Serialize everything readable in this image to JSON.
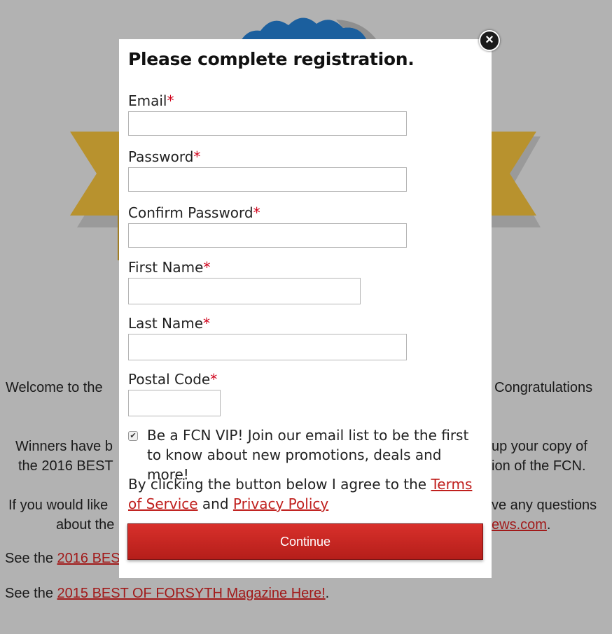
{
  "background": {
    "welcome_left": "Welcome to the",
    "welcome_right": "Congratulations",
    "winners_left": "Winners have b",
    "winners_right": "up your copy of",
    "mag_left": "the 2016 BEST",
    "mag_right": "ion of the FCN.",
    "contact_left": "If you would like",
    "contact_right": "ve any questions",
    "about_left": "about the",
    "about_link": "ews.com",
    "about_end": ".",
    "see_2016_prefix": "See the ",
    "see_2016_link": "2016 BES",
    "see_2015_prefix": "See the ",
    "see_2015_link": "2015 BEST OF FORSYTH Magazine Here!",
    "see_2015_end": "."
  },
  "modal": {
    "title": "Please complete registration.",
    "close_glyph": "×",
    "fields": {
      "email": {
        "label": "Email",
        "value": ""
      },
      "password": {
        "label": "Password",
        "value": ""
      },
      "confirm_password": {
        "label": "Confirm Password",
        "value": ""
      },
      "first_name": {
        "label": "First Name",
        "value": ""
      },
      "last_name": {
        "label": "Last Name",
        "value": ""
      },
      "postal_code": {
        "label": "Postal Code",
        "value": ""
      }
    },
    "required_mark": "*",
    "vip": {
      "checked": true,
      "check_glyph": "✔",
      "text": "Be a FCN VIP! Join our email list to be the first to know about new promotions, deals and more!"
    },
    "terms": {
      "prefix": "By clicking the button below I agree to the ",
      "terms_link": "Terms of Service",
      "middle": " and ",
      "privacy_link": "Privacy Policy"
    },
    "continue_label": "Continue"
  },
  "colors": {
    "overlay": "#b2b2b2",
    "accent_red": "#c0201e",
    "required": "#d0021b",
    "seal_blue": "#1b5f9e",
    "ribbon_gold": "#b8922e"
  }
}
